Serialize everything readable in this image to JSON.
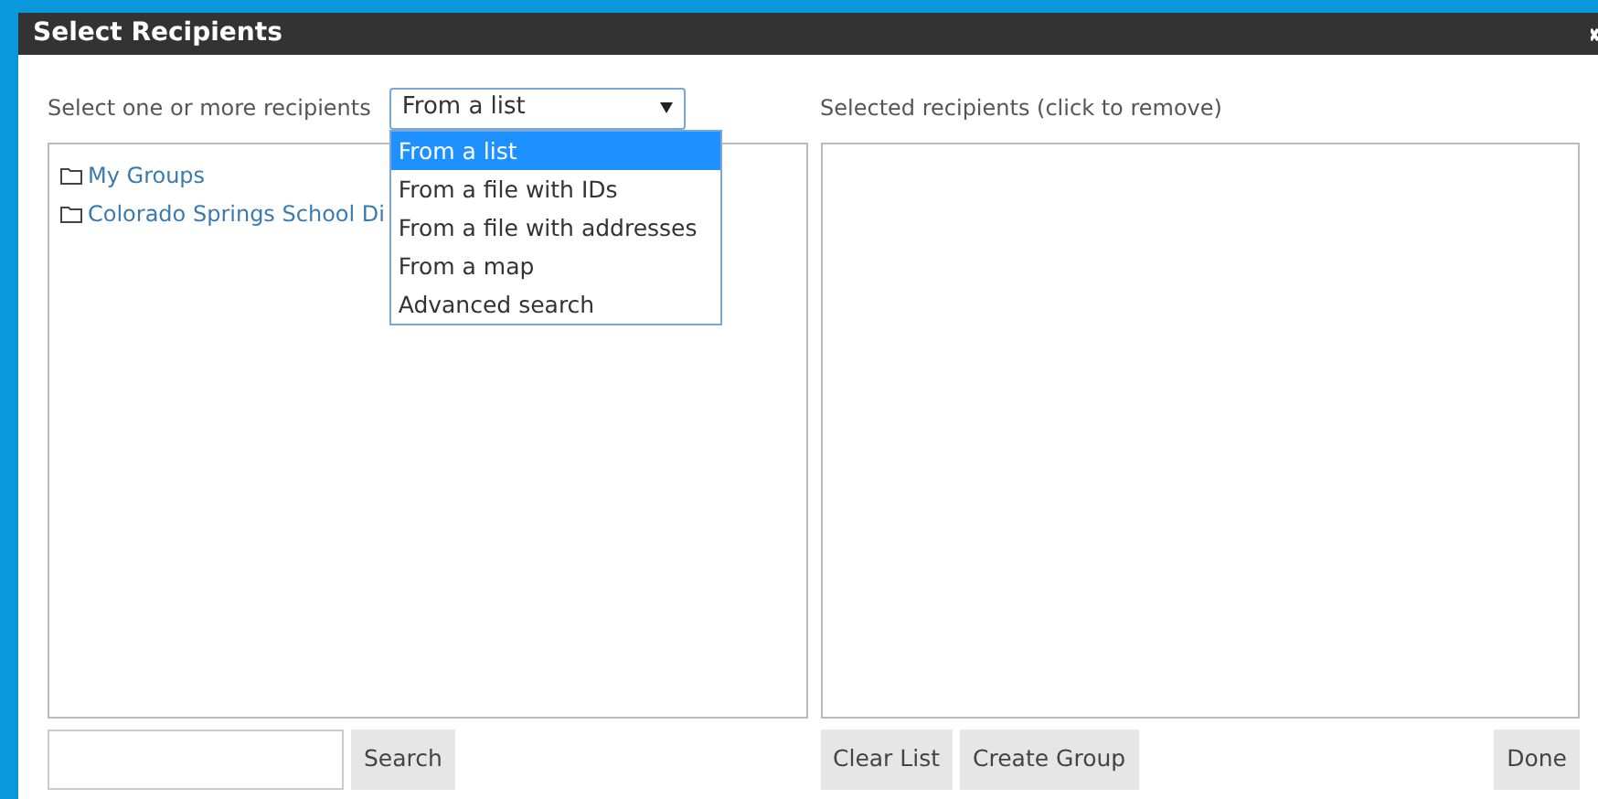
{
  "window": {
    "title": "Select Recipients"
  },
  "source": {
    "label": "Select one or more recipients",
    "value": "From a list",
    "expanded": true,
    "options": [
      {
        "label": "From a list",
        "selected": true
      },
      {
        "label": "From a file with IDs",
        "selected": false
      },
      {
        "label": "From a file with addresses",
        "selected": false
      },
      {
        "label": "From a map",
        "selected": false
      },
      {
        "label": "Advanced search",
        "selected": false
      }
    ]
  },
  "tree": [
    {
      "label": "My Groups"
    },
    {
      "label": "Colorado Springs School Di"
    }
  ],
  "selected_label": "Selected recipients (click to remove)",
  "search_button": "Search",
  "buttons": [
    "Clear List",
    "Create Group"
  ],
  "done_button": "Done"
}
